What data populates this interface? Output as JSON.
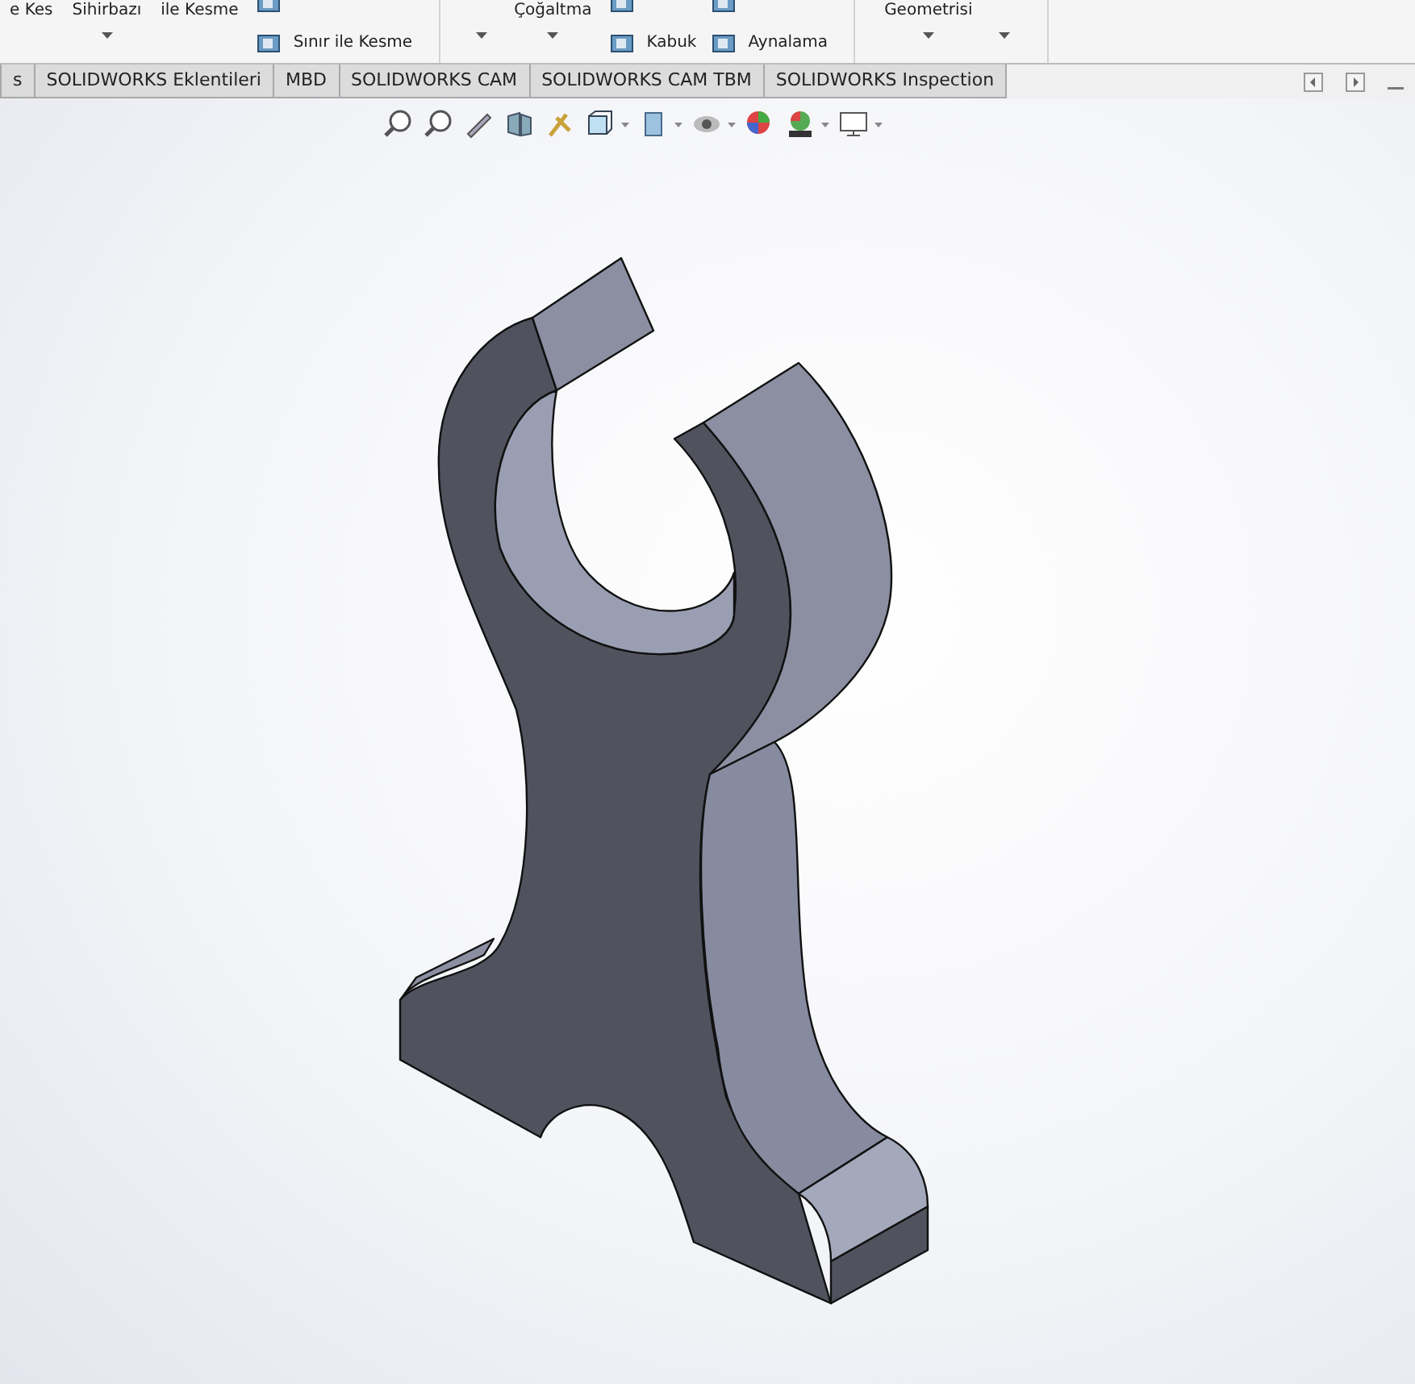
{
  "ribbon": {
    "columns": [
      {
        "kind": "large",
        "label": "e Kes",
        "caret": false
      },
      {
        "kind": "large",
        "label": "Sihirbazı",
        "caret": true
      },
      {
        "kind": "large",
        "label": "ile Kesme",
        "caret": false
      },
      {
        "kind": "small",
        "rows": [
          "",
          "Sınır ile Kesme"
        ]
      },
      {
        "kind": "separator"
      },
      {
        "kind": "large",
        "caret": true
      },
      {
        "kind": "large",
        "label": "Çoğaltma",
        "caret": true
      },
      {
        "kind": "small",
        "rows": [
          "",
          "Kabuk"
        ]
      },
      {
        "kind": "small",
        "rows": [
          "",
          "Aynalama"
        ]
      },
      {
        "kind": "separator"
      },
      {
        "kind": "large",
        "label": "Geometrisi",
        "caret": true
      },
      {
        "kind": "large",
        "caret": true
      },
      {
        "kind": "separator"
      }
    ]
  },
  "tabs": [
    {
      "label": "s",
      "selected": false
    },
    {
      "label": "SOLIDWORKS Eklentileri",
      "selected": false
    },
    {
      "label": "MBD",
      "selected": false
    },
    {
      "label": "SOLIDWORKS CAM",
      "selected": false
    },
    {
      "label": "SOLIDWORKS CAM TBM",
      "selected": false
    },
    {
      "label": "SOLIDWORKS Inspection",
      "selected": false
    }
  ]
}
